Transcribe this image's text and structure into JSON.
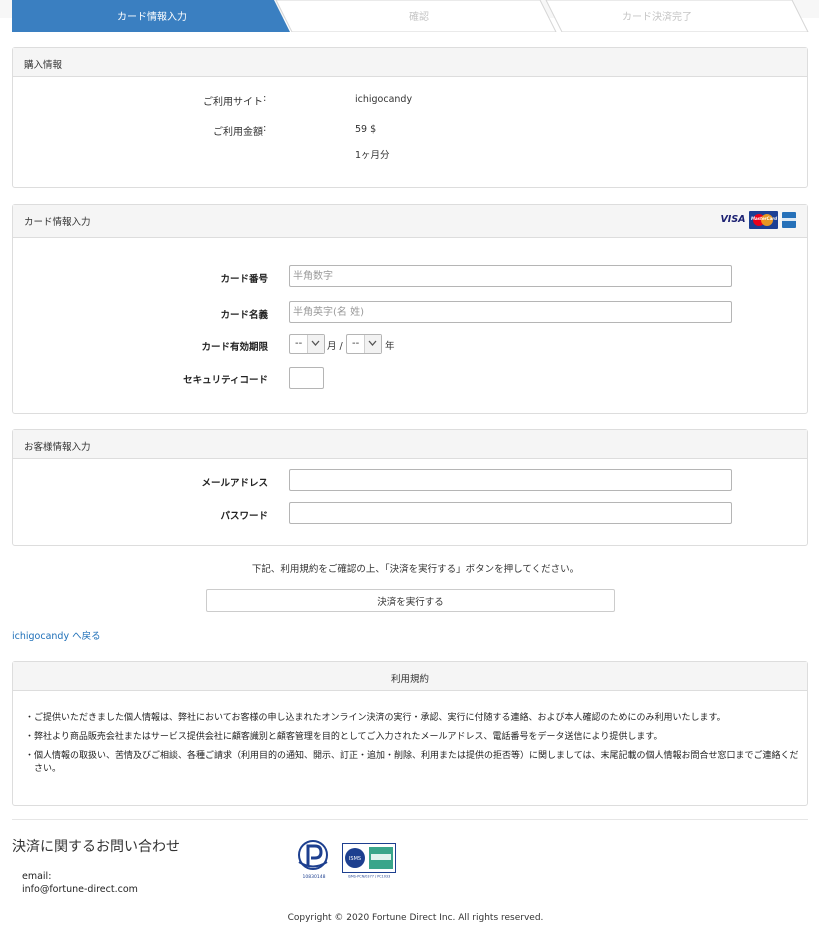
{
  "steps": [
    "カード情報入力",
    "確認",
    "カード決済完了"
  ],
  "colors": {
    "active_step": "#3a7fc1",
    "inactive_step": "#e0e0e0",
    "link": "#1e6fb8",
    "panel_header": "#f5f5f5"
  },
  "purchase": {
    "title": "購入情報",
    "site_label": "ご利用サイト",
    "site_colon": ":",
    "site_value": "ichigocandy",
    "amount_label": "ご利用金額",
    "amount_colon": ":",
    "amount_value": "59 $",
    "period_value": "1ヶ月分"
  },
  "card": {
    "title": "カード情報入力",
    "logos": [
      "visa-logo",
      "mastercard-logo",
      "amex-logo"
    ],
    "visa_text": "VISA",
    "mc_text": "MasterCard",
    "number_label": "カード番号",
    "number_placeholder": "半角数字",
    "name_label": "カード名義",
    "name_placeholder": "半角英字(名 姓)",
    "expiry_label": "カード有効期限",
    "month_value": "--",
    "month_unit": "月 /",
    "year_value": "--",
    "year_unit": "年",
    "cvc_label": "セキュリティコード"
  },
  "customer": {
    "title": "お客様情報入力",
    "email_label": "メールアドレス",
    "password_label": "パスワード"
  },
  "notice": "下記、利用規約をご確認の上、「決済を実行する」ボタンを押してください。",
  "submit_label": "決済を実行する",
  "back_link": "ichigocandy へ戻る",
  "terms": {
    "title": "利用規約",
    "bullet": "・",
    "items": [
      "ご提供いただきました個人情報は、弊社においてお客様の申し込まれたオンライン決済の実行・承認、実行に付随する連絡、および本人確認のためにのみ利用いたします。",
      "弊社より商品販売会社またはサービス提供会社に顧客識別と顧客管理を目的としてご入力されたメールアドレス、電話番号をデータ送信により提供します。",
      "個人情報の取扱い、苦情及びご相談、各種ご請求（利用目的の通知、開示、訂正・追加・削除、利用または提供の拒否等）に関しましては、末尾記載の個人情報お問合せ窓口までご連絡ください。"
    ]
  },
  "contact": {
    "title": "決済に関するお問い合わせ",
    "email_label": "email:",
    "email_value": "info@fortune-direct.com"
  },
  "seals": {
    "privacy_mark_text": "プライバシーマーク",
    "privacy_mark_number": "10830148",
    "isms_text": "ISMS-PCN/0377 / PC1033"
  },
  "copyright": "Copyright © 2020 Fortune Direct Inc. All rights reserved."
}
